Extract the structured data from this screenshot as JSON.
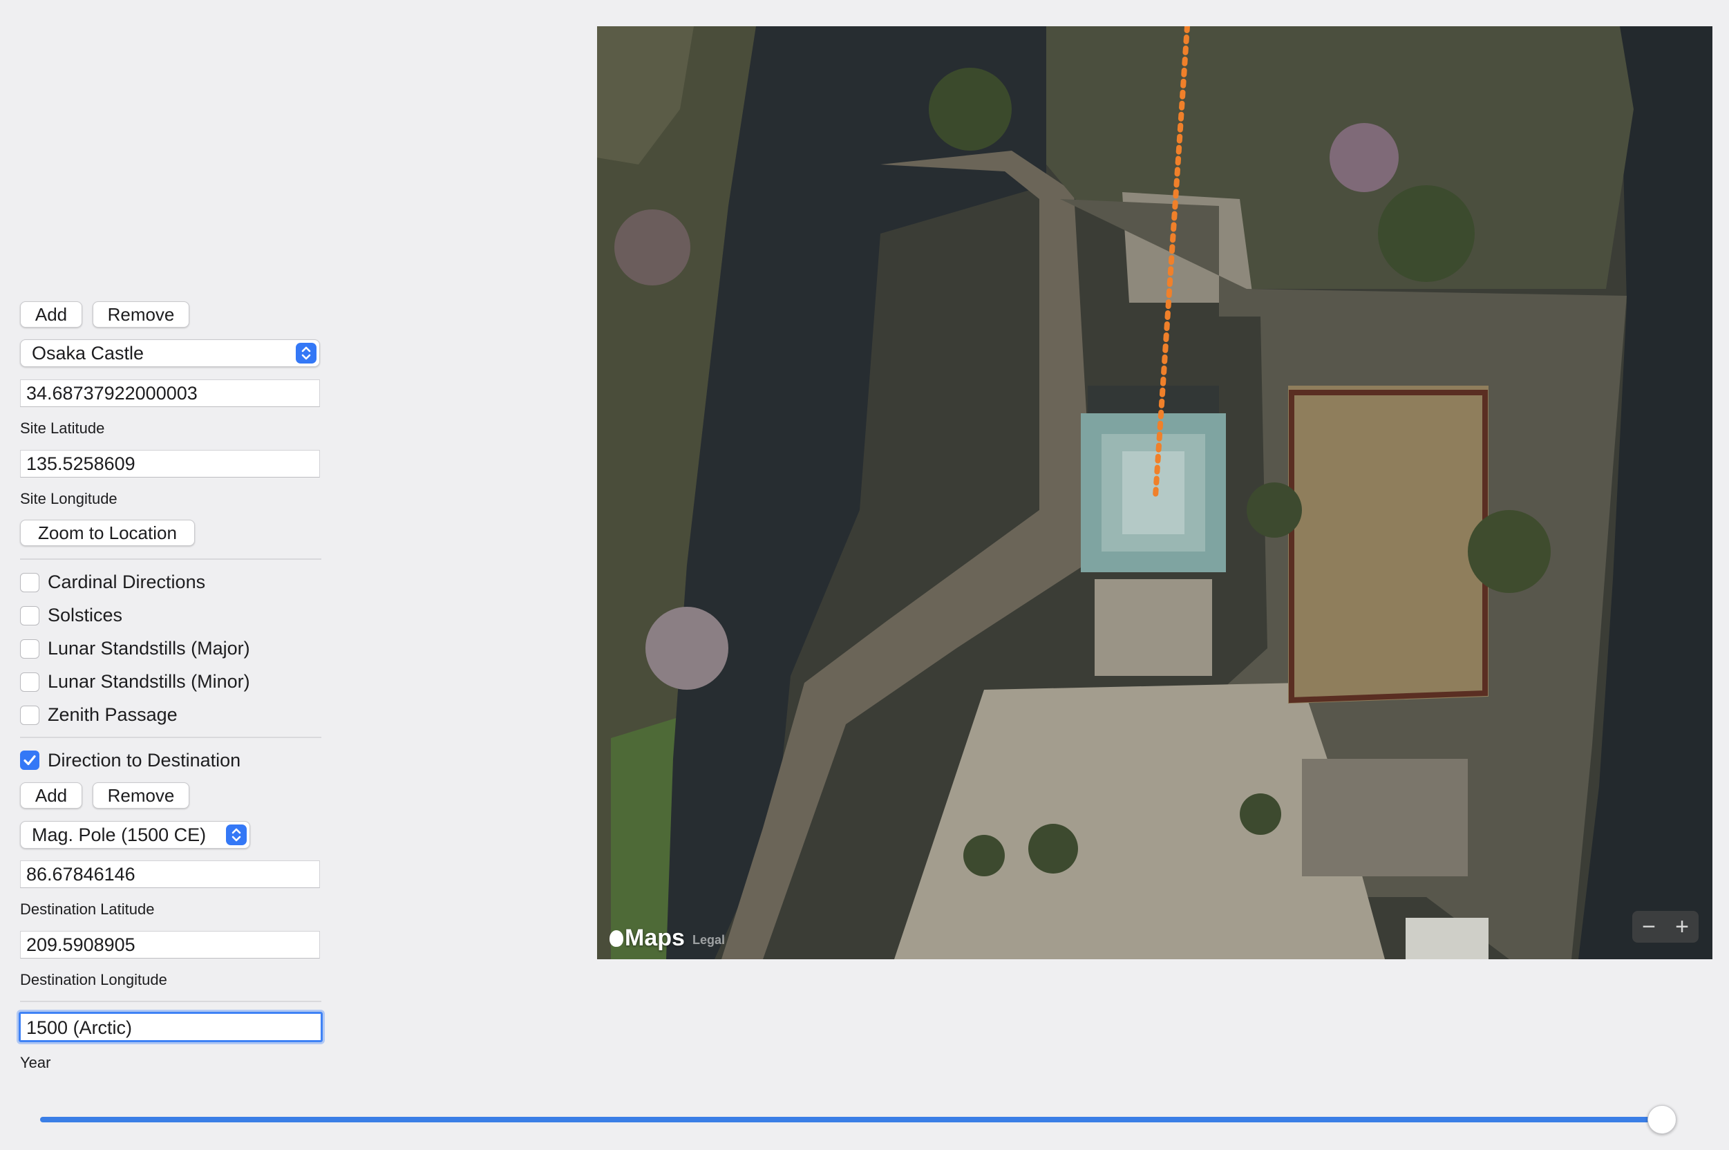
{
  "sites": {
    "add_label": "Add",
    "remove_label": "Remove",
    "selected": "Osaka Castle",
    "latitude_value": "34.68737922000003",
    "latitude_caption": "Site Latitude",
    "longitude_value": "135.5258609",
    "longitude_caption": "Site Longitude",
    "zoom_label": "Zoom to Location"
  },
  "overlays": [
    {
      "label": "Cardinal Directions",
      "checked": false
    },
    {
      "label": "Solstices",
      "checked": false
    },
    {
      "label": "Lunar Standstills (Major)",
      "checked": false
    },
    {
      "label": "Lunar Standstills (Minor)",
      "checked": false
    },
    {
      "label": "Zenith Passage",
      "checked": false
    },
    {
      "label": "Direction to Destination",
      "checked": true
    }
  ],
  "destination": {
    "add_label": "Add",
    "remove_label": "Remove",
    "selected": "Mag. Pole (1500 CE)",
    "latitude_value": "86.67846146",
    "latitude_caption": "Destination Latitude",
    "longitude_value": "209.5908905",
    "longitude_caption": "Destination Longitude",
    "year_value": "1500 (Arctic)",
    "year_caption": "Year"
  },
  "map": {
    "brand": "Maps",
    "legal_label": "Legal",
    "zoom_out_label": "−",
    "zoom_in_label": "+",
    "direction_line_color": "#f0802a"
  },
  "year_slider": {
    "fraction": 0.99
  },
  "colors": {
    "accent": "#3478f6",
    "background": "#efeff1"
  }
}
